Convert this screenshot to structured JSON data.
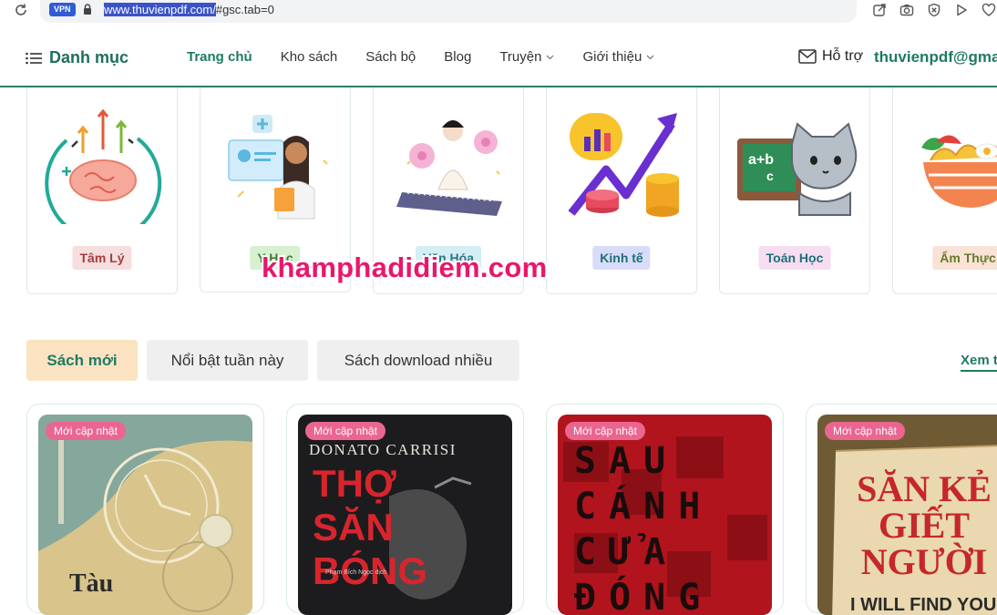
{
  "browser": {
    "vpn_label": "VPN",
    "url_selected": "www.thuvienpdf.com/",
    "url_rest": "#gsc.tab=0",
    "icons": [
      "reload-icon",
      "lock-icon",
      "share-icon",
      "camera-icon",
      "shield-icon",
      "play-icon",
      "heart-icon"
    ]
  },
  "header": {
    "menu_label": "Danh mục",
    "nav": [
      {
        "label": "Trang chủ",
        "active": true
      },
      {
        "label": "Kho sách"
      },
      {
        "label": "Sách bộ"
      },
      {
        "label": "Blog"
      },
      {
        "label": "Truyện",
        "dropdown": true
      },
      {
        "label": "Giới thiệu",
        "dropdown": true
      }
    ],
    "support_label": "Hỗ trợ",
    "email": "thuvienpdf@gma"
  },
  "categories": [
    {
      "label": "Tâm Lý",
      "color": "#f7dede"
    },
    {
      "label": "Y Học",
      "color": "#d6f0d1"
    },
    {
      "label": "Văn Hóa",
      "color": "#d4eef4"
    },
    {
      "label": "Kinh tế",
      "color": "#d9dcf8"
    },
    {
      "label": "Toán Học",
      "color": "#f6ddf2"
    },
    {
      "label": "Ẩm Thực",
      "color": "#f9e2d6"
    }
  ],
  "watermark": "khamphadidiem.com",
  "tabs": [
    {
      "label": "Sách mới",
      "active": true
    },
    {
      "label": "Nổi bật tuần này"
    },
    {
      "label": "Sách download nhiều"
    }
  ],
  "see_all": "Xem t",
  "books": [
    {
      "badge": "Mới cập nhật",
      "cover_text": "Tàu"
    },
    {
      "badge": "Mới cập nhật",
      "author": "DONATO CARRISI",
      "cover_text": "THỢ SĂN BÓNG",
      "translator": "Phạm Bích Ngọc dịch"
    },
    {
      "badge": "Mới cập nhật",
      "cover_text": "SAU CÁNH CỬA ĐÓNG"
    },
    {
      "badge": "Mới cập nhật",
      "cover_text": "SĂN KẺ GIẾT NGƯỜI",
      "tagline": "I WILL FIND YOU"
    }
  ]
}
